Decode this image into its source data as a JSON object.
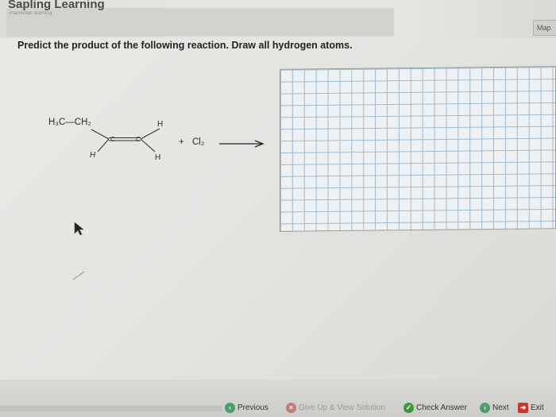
{
  "header": {
    "app_title": "Sapling Learning",
    "subtitle": "macmillan learning",
    "map_label": "Map"
  },
  "question": {
    "prompt": "Predict the product of the following reaction. Draw all hydrogen atoms."
  },
  "reaction": {
    "ethyl_group": "H₃C—CH₂",
    "h_top_right": "H",
    "h_bottom_left": "H",
    "h_bottom_right": "H",
    "carbon_left": "C",
    "carbon_right": "C",
    "plus": "+",
    "reagent": "Cl₂"
  },
  "nav": {
    "previous": "Previous",
    "give_up": "Give Up & View Solution",
    "check_answer": "Check Answer",
    "next": "Next",
    "exit": "Exit"
  },
  "colors": {
    "check_green": "#3a9a3a",
    "nav_green": "#4b9d6a",
    "exit_red": "#c8362e",
    "grid_line": "#9fb8cc"
  }
}
